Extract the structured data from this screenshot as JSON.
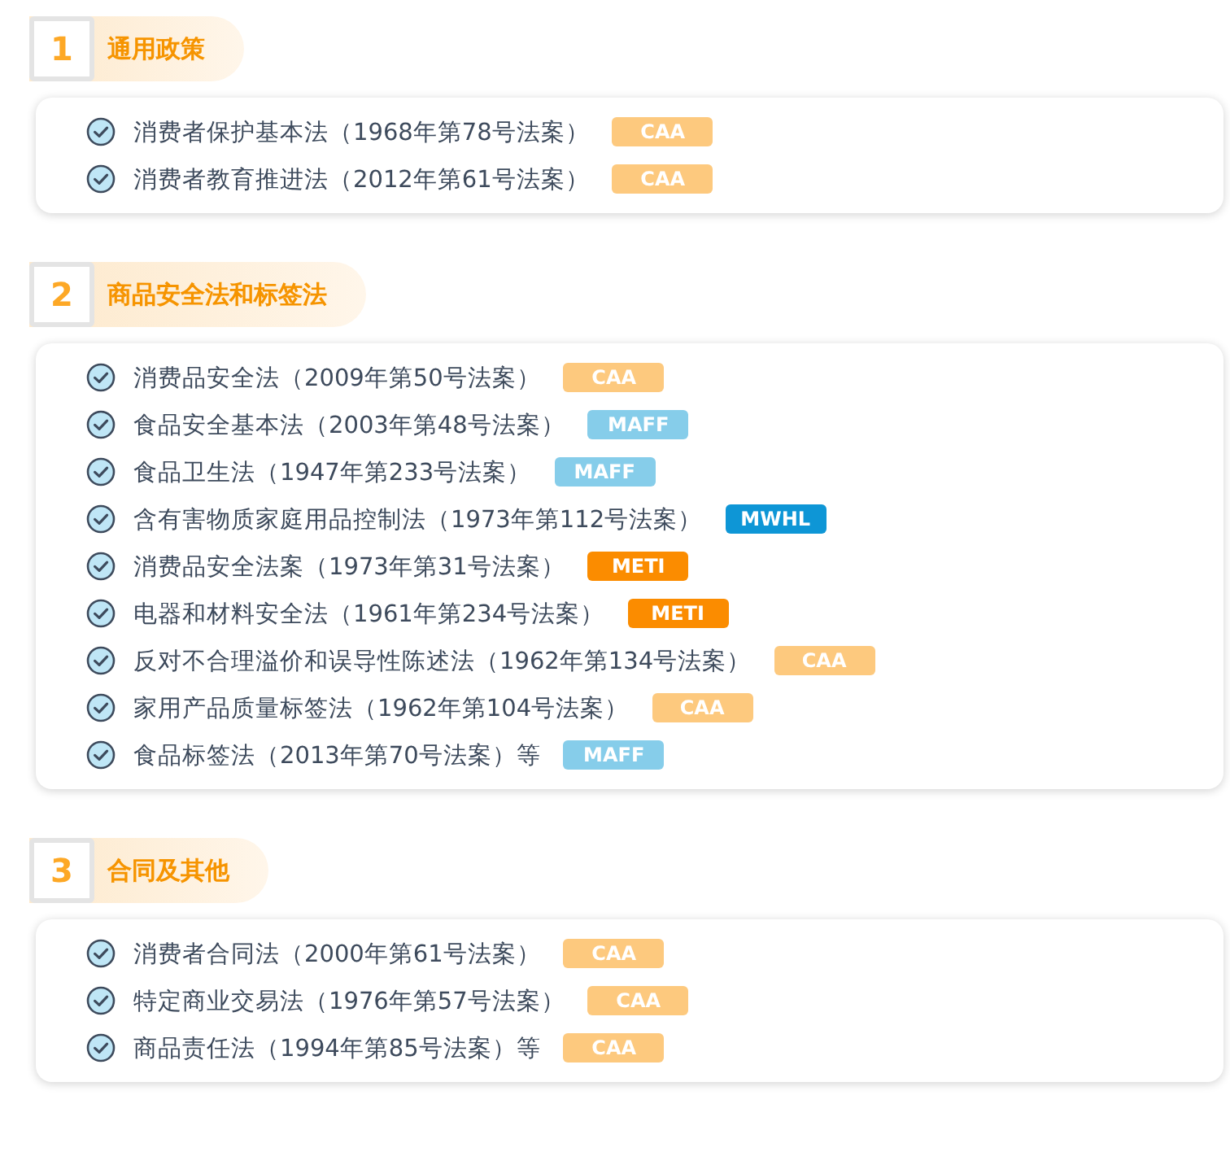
{
  "sections": [
    {
      "number": "1",
      "title": "通用政策",
      "laws": [
        {
          "name": "消费者保护基本法（1968年第78号法案）",
          "agency": "CAA",
          "color": "#fdc97e"
        },
        {
          "name": "消费者教育推进法（2012年第61号法案）",
          "agency": "CAA",
          "color": "#fdc97e"
        }
      ]
    },
    {
      "number": "2",
      "title": "商品安全法和标签法",
      "laws": [
        {
          "name": "消费品安全法（2009年第50号法案）",
          "agency": "CAA",
          "color": "#fdc97e"
        },
        {
          "name": "食品安全基本法（2003年第48号法案）",
          "agency": "MAFF",
          "color": "#86cdea"
        },
        {
          "name": "食品卫生法（1947年第233号法案）",
          "agency": "MAFF",
          "color": "#86cdea"
        },
        {
          "name": "含有害物质家庭用品控制法（1973年第112号法案）",
          "agency": "MWHL",
          "color": "#0e96d6"
        },
        {
          "name": "消费品安全法案（1973年第31号法案）",
          "agency": "METI",
          "color": "#fb8c00"
        },
        {
          "name": "电器和材料安全法（1961年第234号法案）",
          "agency": "METI",
          "color": "#fb8c00"
        },
        {
          "name": "反对不合理溢价和误导性陈述法（1962年第134号法案）",
          "agency": "CAA",
          "color": "#fdc97e"
        },
        {
          "name": "家用产品质量标签法（1962年第104号法案）",
          "agency": "CAA",
          "color": "#fdc97e"
        },
        {
          "name": "食品标签法（2013年第70号法案）等",
          "agency": "MAFF",
          "color": "#86cdea"
        }
      ]
    },
    {
      "number": "3",
      "title": "合同及其他",
      "laws": [
        {
          "name": "消费者合同法（2000年第61号法案）",
          "agency": "CAA",
          "color": "#fdc97e"
        },
        {
          "name": "特定商业交易法（1976年第57号法案）",
          "agency": "CAA",
          "color": "#fdc97e"
        },
        {
          "name": "商品责任法（1994年第85号法案）等",
          "agency": "CAA",
          "color": "#fdc97e"
        }
      ]
    }
  ]
}
